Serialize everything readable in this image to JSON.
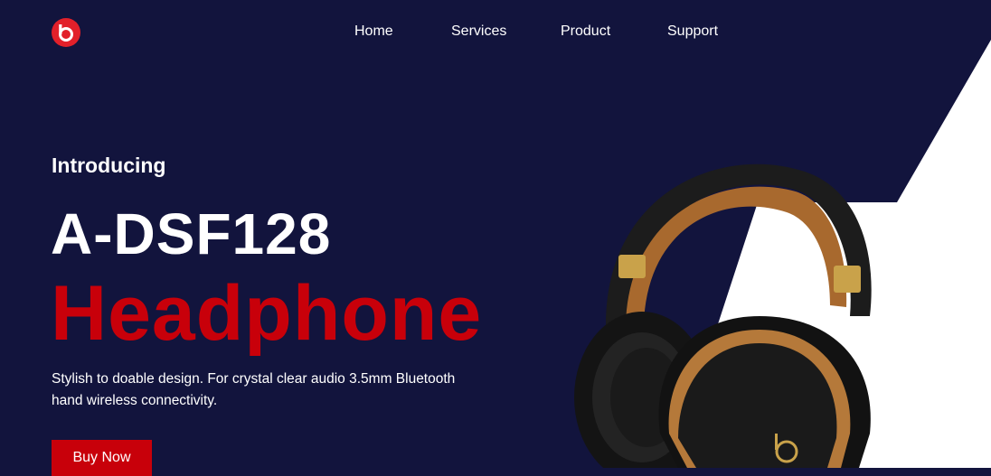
{
  "nav": {
    "logo_icon": "beats-logo-icon",
    "links": [
      "Home",
      "Services",
      "Product",
      "Support"
    ]
  },
  "hero": {
    "eyebrow": "Introducing",
    "model": "A-DSF128",
    "product": "Headphone",
    "description": "Stylish to doable design. For crystal clear audio 3.5mm Bluetooth hand wireless connectivity.",
    "cta_label": "Buy Now",
    "image_icon": "headphone-image"
  },
  "colors": {
    "background": "#12143d",
    "accent": "#c8000a",
    "white": "#ffffff"
  }
}
